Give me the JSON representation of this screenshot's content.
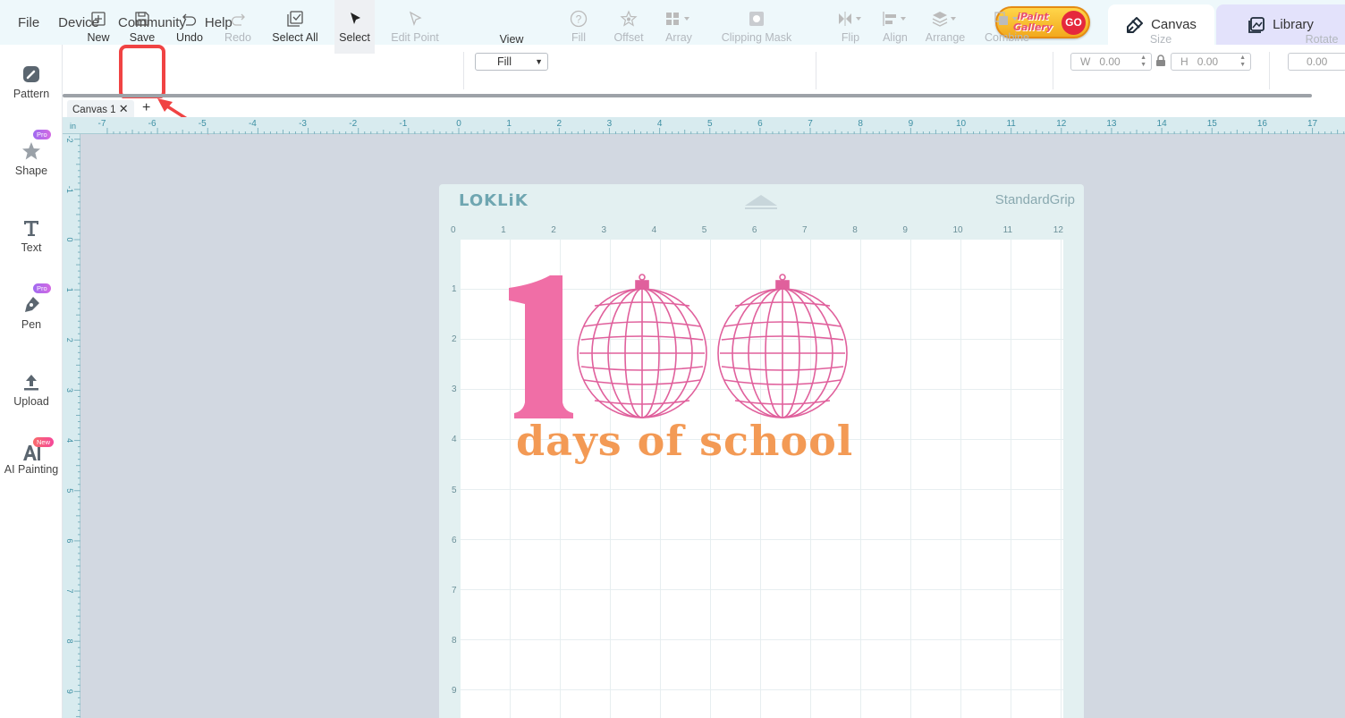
{
  "menu": [
    "File",
    "Device",
    "Community",
    "Help"
  ],
  "gallery": {
    "text": "iPaint Gallery",
    "go": "GO"
  },
  "top_tabs": {
    "canvas": "Canvas",
    "library": "Library"
  },
  "sidebar": [
    {
      "label": "Pattern",
      "icon": "pattern-icon"
    },
    {
      "label": "Shape",
      "icon": "star-icon",
      "badge": "Pro"
    },
    {
      "label": "Text",
      "icon": "text-icon"
    },
    {
      "label": "Pen",
      "icon": "pen-icon",
      "badge": "Pro"
    },
    {
      "label": "Upload",
      "icon": "upload-icon"
    },
    {
      "label": "AI Painting",
      "icon": "ai-icon",
      "badge": "New"
    }
  ],
  "toolbar": {
    "new": "New",
    "save": "Save",
    "undo": "Undo",
    "redo": "Redo",
    "select_all": "Select All",
    "select": "Select",
    "edit_point": "Edit Point",
    "view_value": "Fill",
    "view": "View",
    "fill": "Fill",
    "offset": "Offset",
    "array": "Array",
    "clipping_mask": "Clipping Mask",
    "flip": "Flip",
    "align": "Align",
    "arrange": "Arrange",
    "combine": "Combine",
    "w_label": "W",
    "w_value": "0.00",
    "h_label": "H",
    "h_value": "0.00",
    "size": "Size",
    "rotate_value": "0.00",
    "rotate": "Rotate"
  },
  "doc_tab": "Canvas 1",
  "ruler": {
    "unit": "in",
    "top": [
      "-7",
      "-6",
      "-5",
      "-4",
      "-3",
      "-2",
      "-1",
      "0",
      "1",
      "2",
      "3",
      "4",
      "5",
      "6",
      "7",
      "8",
      "9",
      "10",
      "11",
      "12",
      "13",
      "14",
      "15",
      "16",
      "17"
    ],
    "left": [
      "-2",
      "-1",
      "0",
      "1",
      "2",
      "3",
      "4",
      "5",
      "6",
      "7",
      "8",
      "9"
    ]
  },
  "mat": {
    "brand": "LOKLiK",
    "grip": "StandardGrip",
    "top_nums": [
      "0",
      "1",
      "2",
      "3",
      "4",
      "5",
      "6",
      "7",
      "8",
      "9",
      "10",
      "11",
      "12"
    ],
    "left_nums": [
      "1",
      "2",
      "3",
      "4",
      "5",
      "6",
      "7",
      "8",
      "9"
    ]
  },
  "design": {
    "number": "1",
    "subtitle": "days of school",
    "pink": "#f06ea6",
    "orange": "#f39a55"
  },
  "colors": {
    "accent_red": "#f04343",
    "ruler_text": "#3d8fa3"
  }
}
